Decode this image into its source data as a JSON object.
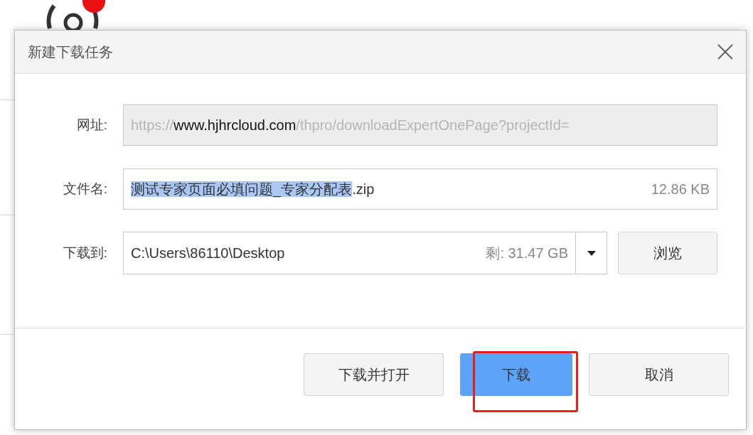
{
  "background": {
    "badge": {
      "color": "#e81010"
    }
  },
  "dialog": {
    "title": "新建下载任务",
    "url": {
      "label": "网址:",
      "parts": [
        {
          "text": "https://",
          "emphasis": false
        },
        {
          "text": "www.hjhrcloud.com",
          "emphasis": true
        },
        {
          "text": "/thpro/downloadExpertOnePage?projectId=",
          "emphasis": false
        }
      ]
    },
    "file_name": {
      "label": "文件名:",
      "parts": [
        {
          "text": "测试专家页面必填问题_专家分配表",
          "selected": true
        },
        {
          "text": ".zip",
          "selected": false
        }
      ],
      "size": "12.86 KB"
    },
    "save_to": {
      "label": "下载到:",
      "path": "C:\\Users\\86110\\Desktop",
      "free_space": "剩: 31.47 GB",
      "browse": "浏览"
    },
    "buttons": [
      {
        "label": "下载并打开",
        "primary": false,
        "highlighted": false
      },
      {
        "label": "下载",
        "primary": true,
        "highlighted": true
      },
      {
        "label": "取消",
        "primary": false,
        "highlighted": false
      }
    ]
  }
}
